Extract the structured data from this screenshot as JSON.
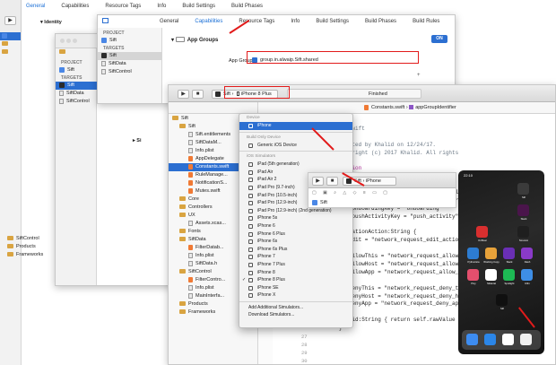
{
  "back_window": {
    "tabs": [
      "General",
      "Capabilities",
      "Resource Tags",
      "Info",
      "Build Settings",
      "Build Phases"
    ],
    "selected_tab": "General",
    "identity_label": "Identity",
    "sidebar_rows": [
      "Sift",
      "Sift",
      "Sift",
      "Sift",
      "Sift",
      "Sift",
      "Sift",
      "Sift"
    ],
    "bottom_rows": [
      "SiftControl",
      "Products",
      "Frameworks"
    ]
  },
  "window2": {
    "project_header": "PROJECT",
    "project_item": "Sift",
    "targets_header": "TARGETS",
    "targets": [
      "Sift",
      "SiftData",
      "SiftControl"
    ],
    "bottom_rows": [
      "SiftControl",
      "Products",
      "Frameworks"
    ],
    "sig_label": "Si"
  },
  "window3": {
    "tabs": [
      "General",
      "Capabilities",
      "Resource Tags",
      "Info",
      "Build Settings",
      "Build Phases",
      "Build Rules"
    ],
    "selected_tab": "Capabilities",
    "project_header": "PROJECT",
    "project_item": "Sift",
    "targets_header": "TARGETS",
    "targets": [
      "Sift",
      "SiftData",
      "SiftControl"
    ],
    "capability_title": "App Groups",
    "toggle_label": "ON",
    "app_groups_label": "App Groups:",
    "app_group_value": "group.in.alwaip.Sift.shared"
  },
  "window4": {
    "scheme": "Sift",
    "device": "iPhone 8 Plus",
    "status": "Finished",
    "breadcrumb": [
      "Constants.swift",
      "appGroupIdentifier"
    ],
    "file_title": "ts.swift",
    "sidebar_rows": [
      {
        "label": "Sift",
        "type": "folder"
      },
      {
        "label": "Sift",
        "type": "folder"
      },
      {
        "label": "Sift.entitlements",
        "type": "file"
      },
      {
        "label": "SiftDataM...",
        "type": "file"
      },
      {
        "label": "Info.plist",
        "type": "file"
      },
      {
        "label": "AppDelegate",
        "type": "swift"
      },
      {
        "label": "Constants.swift",
        "type": "swift",
        "selected": true
      },
      {
        "label": "RuleManage...",
        "type": "swift"
      },
      {
        "label": "NotificationS...",
        "type": "swift"
      },
      {
        "label": "Mutes.swift",
        "type": "swift"
      },
      {
        "label": "Core",
        "type": "folder"
      },
      {
        "label": "Controllers",
        "type": "folder"
      },
      {
        "label": "UX",
        "type": "folder"
      },
      {
        "label": "Assets.xcas...",
        "type": "file"
      },
      {
        "label": "Fonts",
        "type": "folder"
      },
      {
        "label": "SiftData",
        "type": "folder"
      },
      {
        "label": "FilterDatab...",
        "type": "swift"
      },
      {
        "label": "Info.plist",
        "type": "file"
      },
      {
        "label": "SiftData.h",
        "type": "file"
      },
      {
        "label": "SiftControl",
        "type": "folder"
      },
      {
        "label": "FilterContro...",
        "type": "swift"
      },
      {
        "label": "Info.plist",
        "type": "file"
      },
      {
        "label": "MainInterfa...",
        "type": "file"
      },
      {
        "label": "Products",
        "type": "folder"
      },
      {
        "label": "Frameworks",
        "type": "folder"
      }
    ],
    "code_lines": [
      {
        "text": "",
        "cls": ""
      },
      {
        "text": "ts.swift",
        "cls": "cm"
      },
      {
        "text": "",
        "cls": ""
      },
      {
        "text": "Created by Khalid on 12/24/17.",
        "cls": "cm"
      },
      {
        "text": "Copyright (c) 2017 Khalid. All rights",
        "cls": "cm"
      },
      {
        "text": "",
        "cls": ""
      },
      {
        "text": "ndation",
        "cls": "kw"
      },
      {
        "text": "",
        "cls": ""
      },
      {
        "text": "Constants {",
        "cls": ""
      },
      {
        "text": "let appGroupIdentifier = \"group.in.alwaip.Sift.shared\"",
        "cls": "mix"
      },
      {
        "text": "let notificationCategory = \"network_request\"",
        "cls": "mix"
      },
      {
        "text": "let onboardingKey = \"onboarding\"",
        "cls": "mix"
      },
      {
        "text": "let pushActivityKey = \"push_activity\"",
        "cls": "mix"
      },
      {
        "text": "",
        "cls": ""
      },
      {
        "text": "ificationAction:String {",
        "cls": ""
      },
      {
        "text": "se edit = \"network_request_edit_action\"",
        "cls": "mix"
      },
      {
        "text": "",
        "cls": ""
      },
      {
        "text": "se allowThis = \"network_request_allow_this\"",
        "cls": "mix"
      },
      {
        "text": "se allowHost = \"network_request_allow_host\"",
        "cls": "mix"
      },
      {
        "text": "se allowApp = \"network_request_allow_app\"",
        "cls": "mix"
      },
      {
        "text": "",
        "cls": ""
      },
      {
        "text": "se denyThis = \"network_request_deny_this\"",
        "cls": "mix"
      },
      {
        "text": "se denyHost = \"network_request_deny_host\"",
        "cls": "mix"
      },
      {
        "text": "se denyApp = \"network_request_deny_app\"",
        "cls": "mix"
      },
      {
        "text": "",
        "cls": ""
      },
      {
        "text": "var id:String { return self.rawValue }",
        "cls": ""
      },
      {
        "text": "}",
        "cls": ""
      }
    ],
    "line_numbers": [
      "27",
      "28",
      "29",
      "30",
      "31"
    ]
  },
  "device_menu": {
    "device_header": "Device",
    "device_item": "iPhone",
    "build_header": "Build Only Device",
    "build_item": "Generic iOS Device",
    "sim_header": "iOS Simulators",
    "simulators": [
      "iPad (5th generation)",
      "iPad Air",
      "iPad Air 2",
      "iPad Pro (9.7-inch)",
      "iPad Pro (10.5-inch)",
      "iPad Pro (12.9-inch)",
      "iPad Pro (12.9-inch) (2nd generation)",
      "iPhone 5s",
      "iPhone 6",
      "iPhone 6 Plus",
      "iPhone 6s",
      "iPhone 6s Plus",
      "iPhone 7",
      "iPhone 7 Plus",
      "iPhone 8",
      "iPhone 8 Plus",
      "iPhone SE",
      "iPhone X"
    ],
    "checked_item": "iPhone 8 Plus",
    "footer": [
      "Add Additional Simulators...",
      "Download Simulators..."
    ]
  },
  "mini_window": {
    "scheme": "Sift",
    "device": "iPhone",
    "row": "Sift"
  },
  "phone": {
    "time": "22:10",
    "apps": [
      {
        "name": "Sift",
        "color": "#3b3b3b"
      },
      {
        "name": "Slack",
        "color": "#4a154b"
      },
      {
        "name": "OnBoar",
        "color": "#d92f2f"
      },
      {
        "name": "Smvann",
        "color": "#1f1f1f"
      },
      {
        "name": "Pythonista",
        "color": "#2d7cd1"
      },
      {
        "name": "Working Copy",
        "color": "#e7a23a"
      },
      {
        "name": "Slack",
        "color": "#6a2fb5"
      },
      {
        "name": "Dash",
        "color": "#8a3ac9"
      },
      {
        "name": "Pixy",
        "color": "#e34f6d"
      },
      {
        "name": "Sliderial",
        "color": "#ffffff"
      },
      {
        "name": "Spotlight",
        "color": "#1db954"
      },
      {
        "name": "Ulfm",
        "color": "#3e8ee6"
      },
      {
        "name": "Sift",
        "color": "#101010"
      }
    ],
    "dock": [
      {
        "name": "Mail",
        "color": "#3d8cf0"
      },
      {
        "name": "Safari",
        "color": "#2b86e8"
      },
      {
        "name": "Calendar",
        "color": "#ffffff"
      },
      {
        "name": "Photos",
        "color": "#f0f0f0"
      }
    ]
  }
}
